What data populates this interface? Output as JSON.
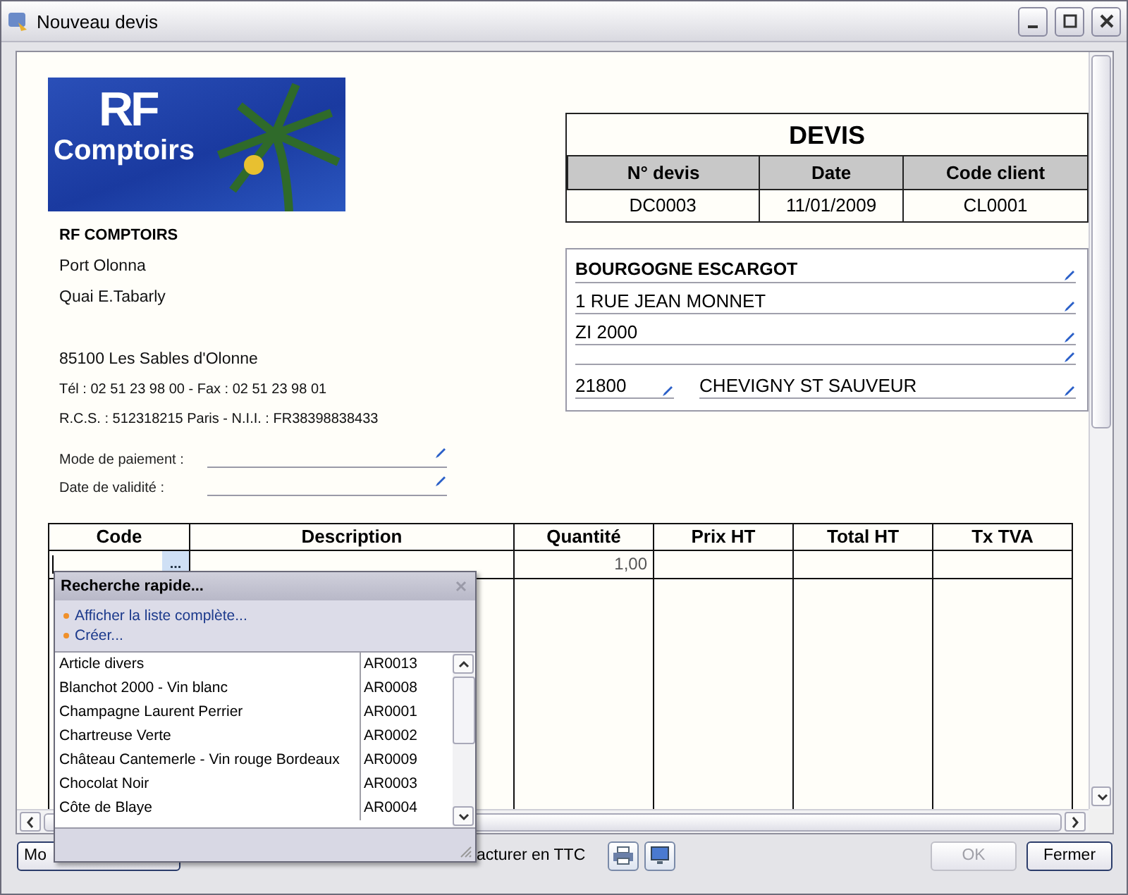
{
  "window": {
    "title": "Nouveau devis"
  },
  "company": {
    "logo_mark": "RF",
    "logo_name": "Comptoirs",
    "name": "RF COMPTOIRS",
    "address_lines": [
      "Port Olonna",
      "Quai E.Tabarly"
    ],
    "city": "85100 Les Sables d'Olonne",
    "contact": "Tél : 02 51 23 98 00 - Fax : 02 51 23 98 01",
    "registration": "R.C.S. : 512318215 Paris - N.I.I. : FR38398838433"
  },
  "fields": [
    {
      "label": "Mode de paiement :"
    },
    {
      "label": "Date de validité :"
    }
  ],
  "quote": {
    "title": "DEVIS",
    "columns": [
      "N° devis",
      "Date",
      "Code client"
    ],
    "values": [
      "DC0003",
      "11/01/2009",
      "CL0001"
    ]
  },
  "client": {
    "name": "BOURGOGNE ESCARGOT",
    "lines": [
      "1 RUE JEAN MONNET",
      "ZI 2000"
    ],
    "postcode": "21800",
    "city": "CHEVIGNY ST SAUVEUR"
  },
  "table": {
    "columns": [
      "Code",
      "Description",
      "Quantité",
      "Prix HT",
      "Total HT",
      "Tx TVA"
    ],
    "edit_row": {
      "lookup_button": "...",
      "quantity": "1,00"
    }
  },
  "quick_search": {
    "title": "Recherche rapide...",
    "links": [
      "Afficher la liste complète...",
      "Créer..."
    ],
    "items": [
      {
        "name": "Article divers",
        "code": "AR0013"
      },
      {
        "name": "Blanchot 2000 - Vin blanc",
        "code": "AR0008"
      },
      {
        "name": "Champagne Laurent Perrier",
        "code": "AR0001"
      },
      {
        "name": "Chartreuse Verte",
        "code": "AR0002"
      },
      {
        "name": "Château Cantemerle - Vin rouge Bordeaux",
        "code": "AR0009"
      },
      {
        "name": "Chocolat Noir",
        "code": "AR0003"
      },
      {
        "name": "Côte de Blaye",
        "code": "AR0004"
      }
    ]
  },
  "footer": {
    "first_button": "Mo",
    "checkbox_label": "acturer en TTC",
    "ok": {
      "label": "OK",
      "disabled": true
    },
    "close": "Fermer"
  }
}
